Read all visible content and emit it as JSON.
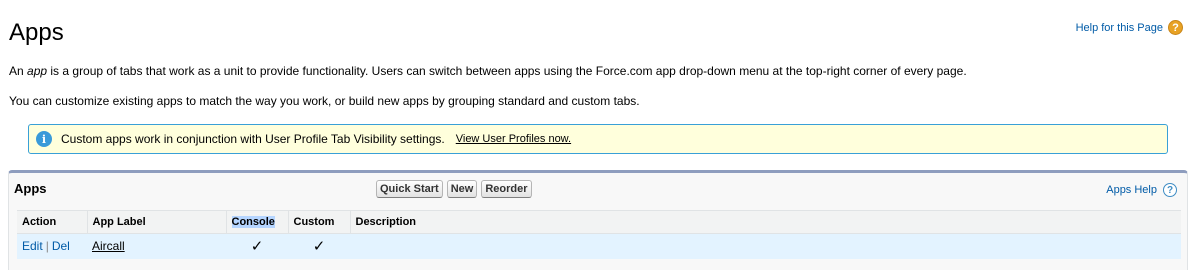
{
  "header": {
    "title": "Apps",
    "help_link": "Help for this Page",
    "help_icon": "?"
  },
  "intro": {
    "part1": "An ",
    "em": "app",
    "part2": " is a group of tabs that work as a unit to provide functionality. Users can switch between apps using the Force.com app drop-down menu at the top-right corner of every page.",
    "line2": "You can customize existing apps to match the way you work, or build new apps by grouping standard and custom tabs."
  },
  "info": {
    "icon": "i",
    "text": "Custom apps work in conjunction with User Profile Tab Visibility settings.",
    "link": "View User Profiles now."
  },
  "panel": {
    "title": "Apps",
    "buttons": {
      "quick_start": "Quick Start",
      "new": "New",
      "reorder": "Reorder"
    },
    "help_label": "Apps Help",
    "help_icon": "?"
  },
  "table": {
    "headers": {
      "action": "Action",
      "label": "App Label",
      "console": "Console",
      "custom": "Custom",
      "description": "Description"
    },
    "rows": [
      {
        "edit": "Edit",
        "sep": "|",
        "del": "Del",
        "label": "Aircall",
        "console": "✓",
        "custom": "✓",
        "description": ""
      }
    ]
  },
  "colors": {
    "link": "#015ba7",
    "panel_border": "#8e9dbe",
    "info_bg": "#ffffdc",
    "info_border": "#39a0d7",
    "row_highlight": "#e3f3ff"
  }
}
